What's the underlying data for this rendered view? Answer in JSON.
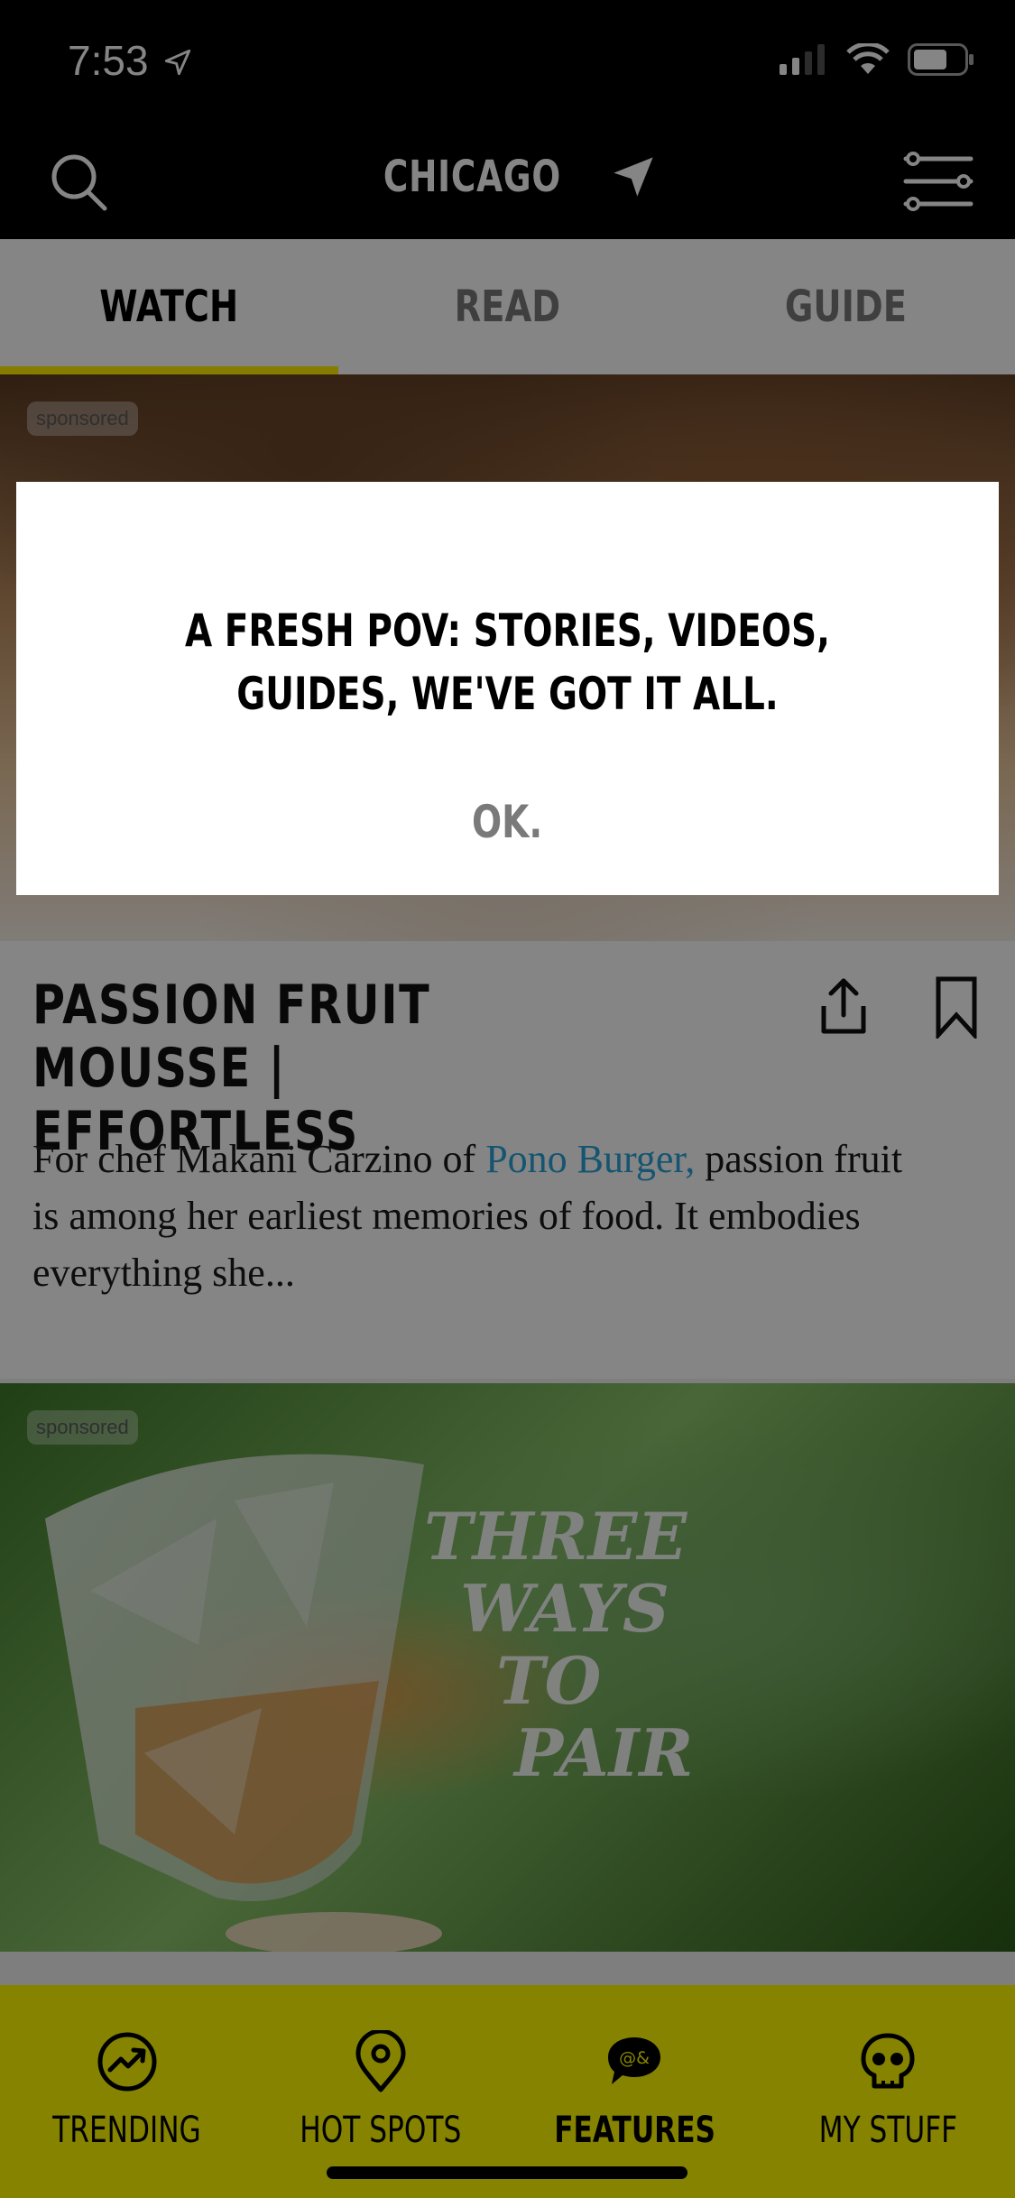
{
  "status_bar": {
    "time": "7:53"
  },
  "header": {
    "city": "CHICAGO"
  },
  "tabs": [
    {
      "label": "WATCH",
      "active": true
    },
    {
      "label": "READ",
      "active": false
    },
    {
      "label": "GUIDE",
      "active": false
    }
  ],
  "feed": {
    "items": [
      {
        "badge": "sponsored",
        "title": "PASSION FRUIT MOUSSE | EFFORTLESS",
        "desc_prefix": "For chef Makani Carzino of ",
        "desc_link": "Pono Burger,",
        "desc_suffix": " passion fruit is among her earliest memories of food. It embodies everything she..."
      },
      {
        "badge": "sponsored",
        "image_text": [
          "THREE",
          "WAYS",
          "TO",
          "PAIR"
        ]
      }
    ]
  },
  "dialog": {
    "message": "A FRESH POV: STORIES, VIDEOS, GUIDES, WE'VE GOT IT ALL.",
    "ok_label": "OK."
  },
  "bottom_nav": [
    {
      "label": "TRENDING",
      "icon": "trending-icon",
      "active": false
    },
    {
      "label": "HOT SPOTS",
      "icon": "map-pin-icon",
      "active": false
    },
    {
      "label": "FEATURES",
      "icon": "chat-bubble-icon",
      "active": true
    },
    {
      "label": "MY STUFF",
      "icon": "skull-icon",
      "active": false
    }
  ],
  "colors": {
    "accent": "#fffc00",
    "tab_indicator": "#ffed00",
    "link": "#2aa3d8"
  }
}
